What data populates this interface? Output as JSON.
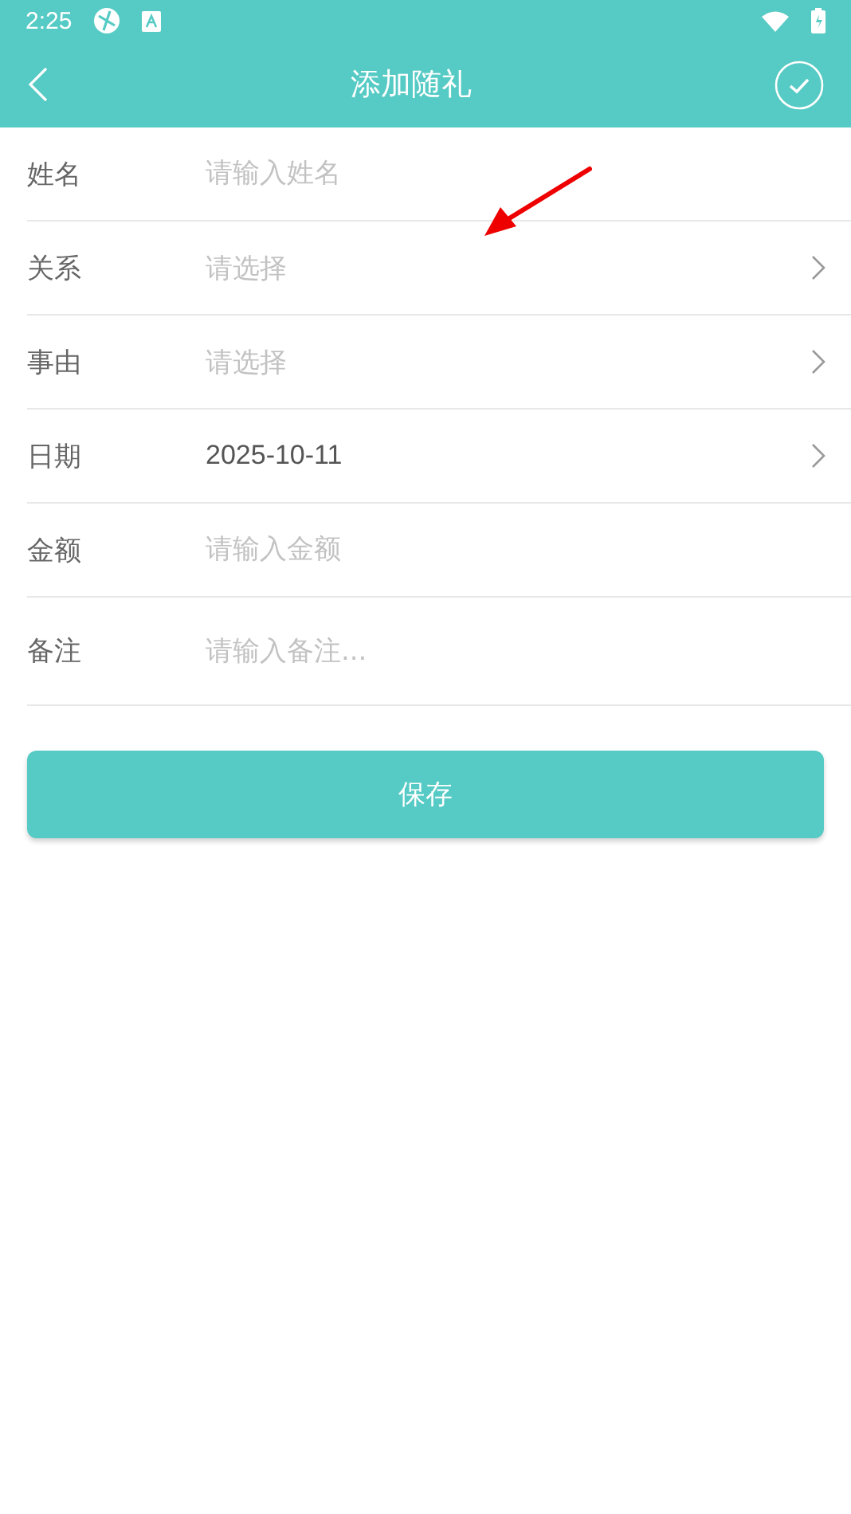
{
  "status_bar": {
    "time": "2:25"
  },
  "toolbar": {
    "title": "添加随礼"
  },
  "form": {
    "rows": [
      {
        "kind": "input",
        "label": "姓名",
        "placeholder": "请输入姓名"
      },
      {
        "kind": "select",
        "label": "关系",
        "placeholder": "请选择"
      },
      {
        "kind": "select",
        "label": "事由",
        "placeholder": "请选择"
      },
      {
        "kind": "select",
        "label": "日期",
        "value": "2025-10-11"
      },
      {
        "kind": "input",
        "label": "金额",
        "placeholder": "请输入金额"
      },
      {
        "kind": "textarea",
        "label": "备注",
        "placeholder": "请输入备注..."
      }
    ]
  },
  "save_button": {
    "label": "保存"
  }
}
